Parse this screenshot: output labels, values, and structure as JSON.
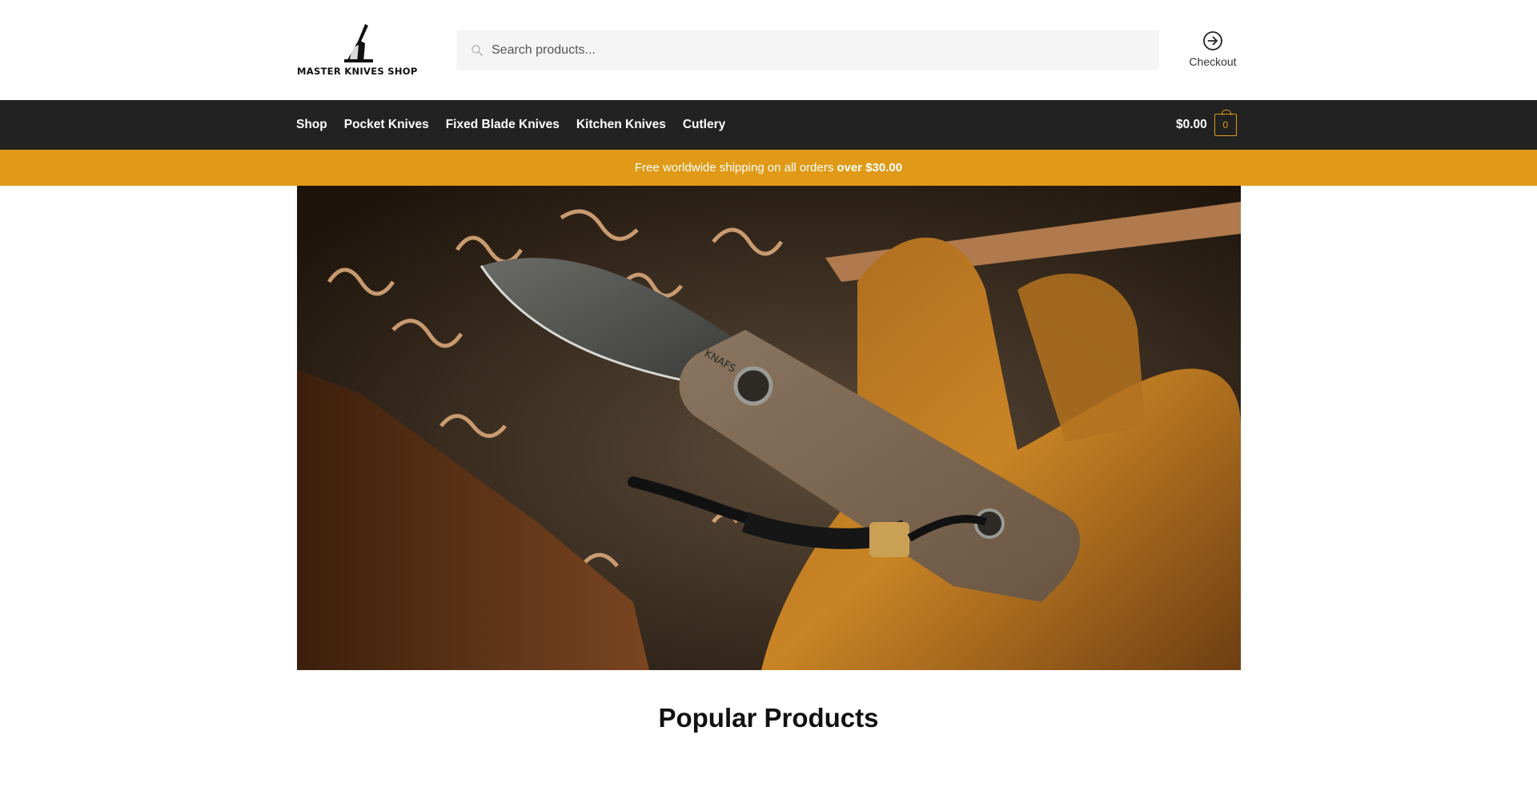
{
  "header": {
    "logo_text": "MASTER KNIVES SHOP",
    "search_placeholder": "Search products...",
    "checkout_label": "Checkout"
  },
  "nav": {
    "items": [
      {
        "label": "Shop"
      },
      {
        "label": "Pocket Knives"
      },
      {
        "label": "Fixed Blade Knives"
      },
      {
        "label": "Kitchen Knives"
      },
      {
        "label": "Cutlery"
      }
    ],
    "cart_total": "$0.00",
    "cart_count": "0"
  },
  "promo": {
    "text": "Free worldwide shipping on all orders",
    "highlight": "over $30.00"
  },
  "hero": {
    "blade_mark": "KNAFS"
  },
  "main": {
    "section_title": "Popular Products"
  },
  "colors": {
    "accent": "#e09a17",
    "nav_bg": "#222222",
    "search_bg": "#f5f5f5"
  },
  "icons": {
    "search": "search-icon",
    "checkout": "arrow-circle-right-icon",
    "cart": "shopping-bag-icon"
  }
}
